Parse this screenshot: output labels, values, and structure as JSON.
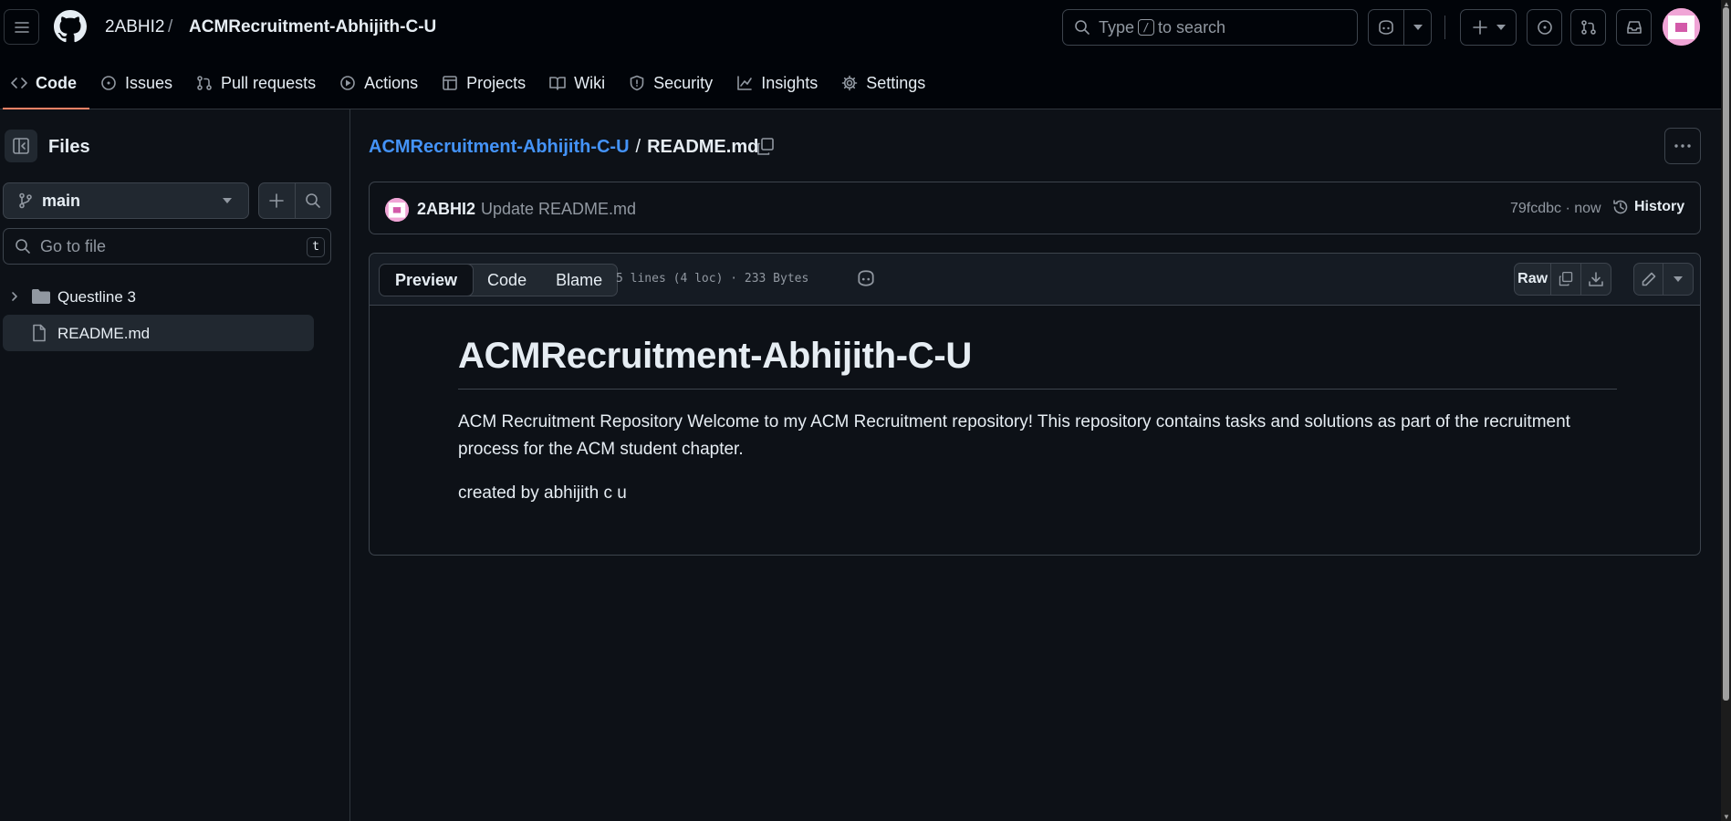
{
  "header": {
    "owner": "2ABHI2",
    "separator": "/",
    "repo": "ACMRecruitment-Abhijith-C-U",
    "search": {
      "prefix": "Type",
      "key": "/",
      "suffix": "to search"
    }
  },
  "nav": {
    "tabs": [
      {
        "label": "Code",
        "icon": "code-icon",
        "active": true
      },
      {
        "label": "Issues",
        "icon": "issue-opened-icon"
      },
      {
        "label": "Pull requests",
        "icon": "git-pull-request-icon"
      },
      {
        "label": "Actions",
        "icon": "play-icon"
      },
      {
        "label": "Projects",
        "icon": "table-icon"
      },
      {
        "label": "Wiki",
        "icon": "book-icon"
      },
      {
        "label": "Security",
        "icon": "shield-icon"
      },
      {
        "label": "Insights",
        "icon": "graph-icon"
      },
      {
        "label": "Settings",
        "icon": "gear-icon"
      }
    ]
  },
  "sidebar": {
    "title": "Files",
    "branch": "main",
    "goto_placeholder": "Go to file",
    "goto_key": "t",
    "tree": [
      {
        "label": "Questline 3",
        "type": "folder"
      },
      {
        "label": "README.md",
        "type": "file",
        "selected": true
      }
    ]
  },
  "main": {
    "path_repo": "ACMRecruitment-Abhijith-C-U",
    "path_sep": "/",
    "path_file": "README.md",
    "commit": {
      "author": "2ABHI2",
      "message": "Update README.md",
      "meta": "79fcdbc · now",
      "history_label": "History"
    },
    "file": {
      "tabs": [
        "Preview",
        "Code",
        "Blame"
      ],
      "active_tab": "Preview",
      "stats": "5 lines (4 loc) · 233 Bytes",
      "raw_label": "Raw"
    },
    "readme": {
      "heading": "ACMRecruitment-Abhijith-C-U",
      "paragraph1": "ACM Recruitment Repository Welcome to my ACM Recruitment repository! This repository contains tasks and solutions as part of the recruitment process for the ACM student chapter.",
      "paragraph2": "created by abhijith c u"
    }
  },
  "colors": {
    "background": "#0d1117",
    "header_bg": "#010409",
    "link": "#4493f8",
    "active_tab_underline": "#f78166",
    "avatar": "#f0a5d6"
  }
}
